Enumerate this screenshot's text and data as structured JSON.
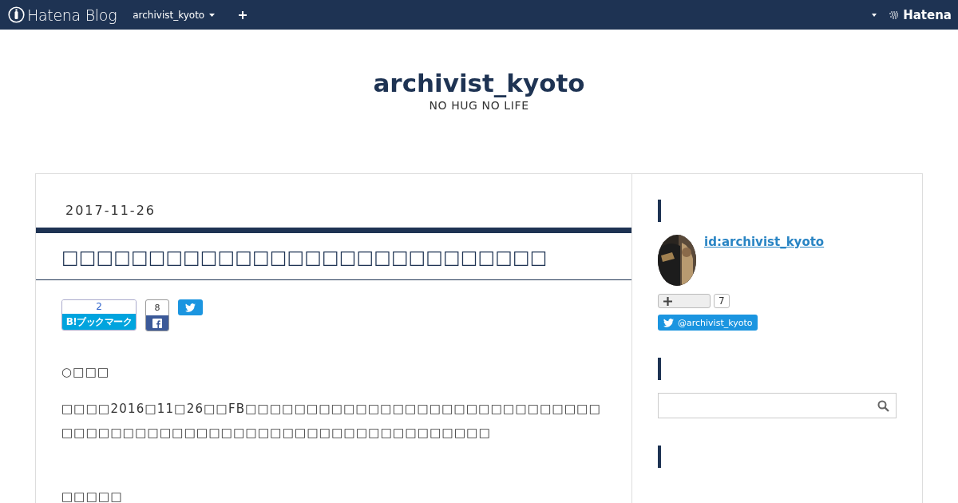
{
  "top_bar": {
    "logo": "Hatena Blog",
    "blog_menu": "archivist_kyoto",
    "brand": "Hatena"
  },
  "blog": {
    "title": "archivist_kyoto",
    "subtitle": "NO HUG NO LIFE"
  },
  "entry": {
    "date": "2017-11-26",
    "title": "□□□□□□□□□□□□□□□□□□□□□□□□□□□□",
    "share": {
      "bookmark_count": "2",
      "bookmark_label": "B!ブックマーク",
      "facebook_count": "8"
    },
    "paragraphs": [
      {
        "kind": "heading",
        "text": "○□□□"
      },
      {
        "kind": "text",
        "text": "□□□□2016□11□26□□FB□□□□□□□□□□□□□□□□□□□□□□□□□□□□□□□□□□□□□□□□□□□□□□□□□□□□□□□□□□□□□□□□"
      },
      {
        "kind": "spacer"
      },
      {
        "kind": "heading",
        "text": "□□□□□"
      }
    ]
  },
  "sidebar": {
    "profile": {
      "id": "id:archivist_kyoto",
      "follow_count": "7",
      "twitter": "@archivist_kyoto"
    }
  }
}
